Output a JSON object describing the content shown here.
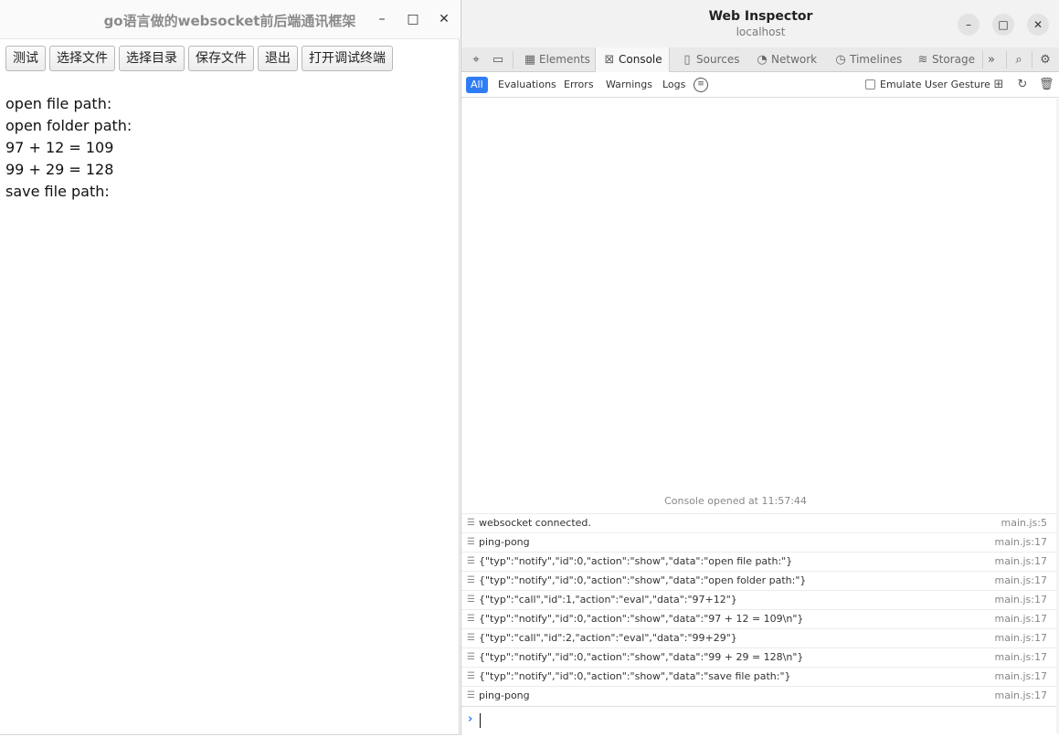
{
  "app": {
    "title": "go语言做的websocket前后端通讯框架",
    "controls": {
      "minimize": "–",
      "maximize": "□",
      "close": "✕"
    },
    "buttons": [
      "测试",
      "选择文件",
      "选择目录",
      "保存文件",
      "退出",
      "打开调试终端"
    ],
    "output_lines": [
      "open file path:",
      "open folder path:",
      "97 + 12 = 109",
      "99 + 29 = 128",
      "save file path:"
    ]
  },
  "inspector": {
    "title": "Web Inspector",
    "subtitle": "localhost",
    "controls": {
      "minimize": "–",
      "maximize": "□",
      "close": "✕"
    },
    "tabs": [
      {
        "label": "Elements",
        "icon": "elements-icon",
        "glyph": "▦"
      },
      {
        "label": "Console",
        "icon": "console-icon",
        "glyph": "⊠"
      },
      {
        "label": "Sources",
        "icon": "sources-icon",
        "glyph": "▯"
      },
      {
        "label": "Network",
        "icon": "network-icon",
        "glyph": "◔"
      },
      {
        "label": "Timelines",
        "icon": "timelines-icon",
        "glyph": "◷"
      },
      {
        "label": "Storage",
        "icon": "storage-icon",
        "glyph": "≋"
      }
    ],
    "active_tab": "Console",
    "filters": [
      "All",
      "Evaluations",
      "Errors",
      "Warnings",
      "Logs"
    ],
    "active_filter": "All",
    "emulate_label": "Emulate User Gesture",
    "console_opened": "Console opened at 11:57:44",
    "log": [
      {
        "msg": "websocket connected.",
        "src": "main.js:5"
      },
      {
        "msg": "ping-pong",
        "src": "main.js:17"
      },
      {
        "msg": "{\"typ\":\"notify\",\"id\":0,\"action\":\"show\",\"data\":\"open file path:\"}",
        "src": "main.js:17"
      },
      {
        "msg": "{\"typ\":\"notify\",\"id\":0,\"action\":\"show\",\"data\":\"open folder path:\"}",
        "src": "main.js:17"
      },
      {
        "msg": "{\"typ\":\"call\",\"id\":1,\"action\":\"eval\",\"data\":\"97+12\"}",
        "src": "main.js:17"
      },
      {
        "msg": "{\"typ\":\"notify\",\"id\":0,\"action\":\"show\",\"data\":\"97 + 12 = 109\\n\"}",
        "src": "main.js:17"
      },
      {
        "msg": "{\"typ\":\"call\",\"id\":2,\"action\":\"eval\",\"data\":\"99+29\"}",
        "src": "main.js:17"
      },
      {
        "msg": "{\"typ\":\"notify\",\"id\":0,\"action\":\"show\",\"data\":\"99 + 29 = 128\\n\"}",
        "src": "main.js:17"
      },
      {
        "msg": "{\"typ\":\"notify\",\"id\":0,\"action\":\"show\",\"data\":\"save file path:\"}",
        "src": "main.js:17"
      },
      {
        "msg": "ping-pong",
        "src": "main.js:17"
      }
    ],
    "accent_color": "#2f7df6"
  }
}
